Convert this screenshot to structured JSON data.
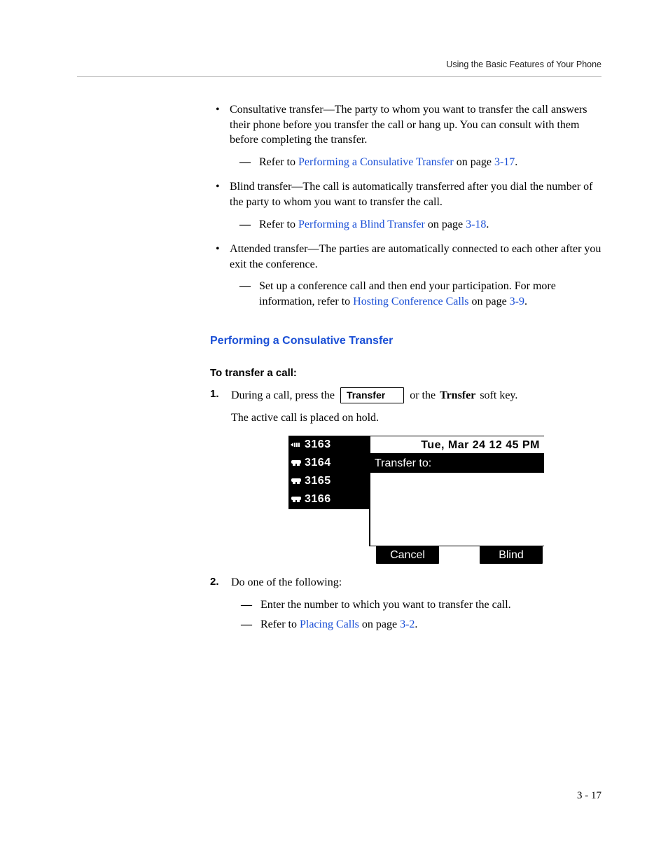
{
  "header": {
    "running_head": "Using the Basic Features of Your Phone"
  },
  "bullets": {
    "b1_text_a": "Consultative transfer—The party to whom you want to transfer the call answers their phone before you transfer the call or hang up. You can consult with them before completing the transfer.",
    "b1_sub_prefix": "Refer to ",
    "b1_sub_link": "Performing a Consulative Transfer",
    "b1_sub_mid": " on page ",
    "b1_sub_page": "3-17",
    "b1_sub_end": ".",
    "b2_text": "Blind transfer—The call is automatically transferred after you dial the number of the party to whom you want to transfer the call.",
    "b2_sub_prefix": "Refer to ",
    "b2_sub_link": "Performing a Blind Transfer",
    "b2_sub_mid": " on page ",
    "b2_sub_page": "3-18",
    "b2_sub_end": ".",
    "b3_text": "Attended transfer—The parties are automatically connected to each other after you exit the conference.",
    "b3_sub_prefix": "Set up a conference call and then end your participation. For more information, refer to ",
    "b3_sub_link": "Hosting Conference Calls",
    "b3_sub_mid": " on page ",
    "b3_sub_page": "3-9",
    "b3_sub_end": "."
  },
  "heading2": "Performing a Consulative Transfer",
  "heading3": "To transfer a call:",
  "step1": {
    "pre": "During a call, press the ",
    "button": "Transfer",
    "post_a": " or the ",
    "bold": "Trnsfer",
    "post_b": " soft key.",
    "note": "The active call is placed on hold."
  },
  "phone": {
    "lines": [
      "3163",
      "3164",
      "3165",
      "3166"
    ],
    "status": "Tue, Mar 24  12 45 PM",
    "title": "Transfer to:",
    "soft_left": "Cancel",
    "soft_right": "Blind"
  },
  "step2": {
    "text": "Do one of the following:",
    "sub1": "Enter the number to which you want to transfer the call.",
    "sub2_prefix": "Refer to ",
    "sub2_link": "Placing Calls",
    "sub2_mid": " on page ",
    "sub2_page": "3-2",
    "sub2_end": "."
  },
  "page_number": "3 - 17"
}
